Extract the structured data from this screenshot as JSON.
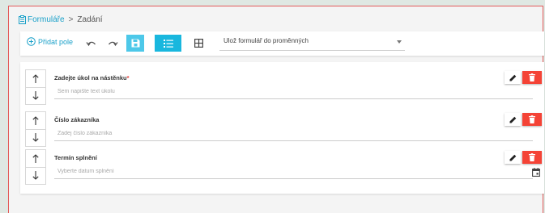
{
  "breadcrumb": {
    "root": "Formuláře",
    "separator": ">",
    "current": "Zadání"
  },
  "toolbar": {
    "add_field": "Přidat pole",
    "save_target": "Ulož formulář do proměnných",
    "icons": {
      "add": "plus-circle-icon",
      "undo": "undo-icon",
      "redo": "redo-icon",
      "save": "save-icon",
      "list_view": "list-view-icon",
      "grid_view": "grid-view-icon"
    }
  },
  "fields": [
    {
      "label": "Zadejte úkol na nástěnku",
      "required_mark": "*",
      "placeholder": "Sem napište text úkolu"
    },
    {
      "label": "Číslo zákazníka",
      "required_mark": "",
      "placeholder": "Zadej číslo zákazníka"
    },
    {
      "label": "Termín splnění",
      "required_mark": "",
      "placeholder": "Vyberte datum splnění"
    }
  ],
  "colors": {
    "accent": "#1ba1c9",
    "active": "#19b7de",
    "danger": "#f44336",
    "frame": "#e35b5b"
  }
}
